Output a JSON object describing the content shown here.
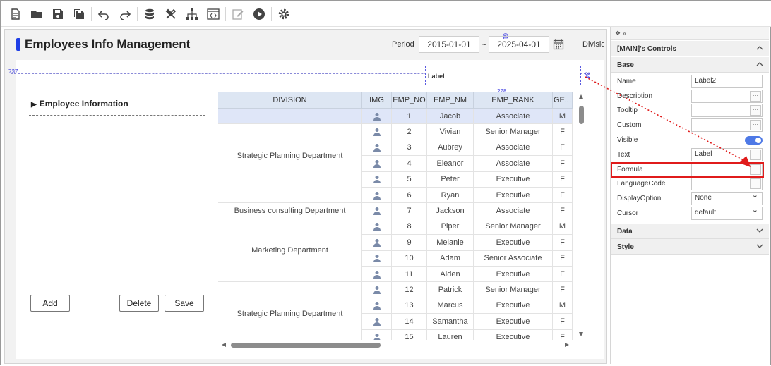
{
  "toolbar": {
    "icons": [
      "new-document-icon",
      "open-folder-icon",
      "save-icon",
      "save-all-icon",
      "undo-icon",
      "redo-icon",
      "database-icon",
      "tools-icon",
      "hierarchy-icon",
      "code-view-icon",
      "edit-icon",
      "run-icon",
      "settings-icon"
    ]
  },
  "header": {
    "title": "Employees Info Management",
    "period_label": "Period",
    "date_from": "2015-01-01",
    "date_to": "2025-04-01",
    "tilde": "~",
    "division_label": "Divisio"
  },
  "guides": {
    "label_737": "737",
    "label_278": "278",
    "label_34": "34",
    "label_61": "61"
  },
  "selected_control": {
    "text": "Label"
  },
  "left_panel": {
    "title": "Employee Information",
    "add_label": "Add",
    "delete_label": "Delete",
    "save_label": "Save"
  },
  "grid": {
    "columns": [
      "DIVISION",
      "IMG",
      "EMP_NO",
      "EMP_NM",
      "EMP_RANK",
      "GE..."
    ],
    "divisions": [
      {
        "name": "Strategic Planning Department",
        "rows": 6
      },
      {
        "name": "Business consulting Department",
        "rows": 1
      },
      {
        "name": "Marketing Department",
        "rows": 4
      },
      {
        "name": "Strategic Planning Department",
        "rows": 4
      }
    ],
    "rows": [
      {
        "no": "1",
        "name": "Jacob",
        "rank": "Associate",
        "gender": "M"
      },
      {
        "no": "2",
        "name": "Vivian",
        "rank": "Senior Manager",
        "gender": "F"
      },
      {
        "no": "3",
        "name": "Aubrey",
        "rank": "Associate",
        "gender": "F"
      },
      {
        "no": "4",
        "name": "Eleanor",
        "rank": "Associate",
        "gender": "F"
      },
      {
        "no": "5",
        "name": "Peter",
        "rank": "Executive",
        "gender": "F"
      },
      {
        "no": "6",
        "name": "Ryan",
        "rank": "Executive",
        "gender": "F"
      },
      {
        "no": "7",
        "name": "Jackson",
        "rank": "Associate",
        "gender": "F"
      },
      {
        "no": "8",
        "name": "Piper",
        "rank": "Senior Manager",
        "gender": "M"
      },
      {
        "no": "9",
        "name": "Melanie",
        "rank": "Executive",
        "gender": "F"
      },
      {
        "no": "10",
        "name": "Adam",
        "rank": "Senior Associate",
        "gender": "F"
      },
      {
        "no": "11",
        "name": "Aiden",
        "rank": "Executive",
        "gender": "F"
      },
      {
        "no": "12",
        "name": "Patrick",
        "rank": "Senior Manager",
        "gender": "F"
      },
      {
        "no": "13",
        "name": "Marcus",
        "rank": "Executive",
        "gender": "M"
      },
      {
        "no": "14",
        "name": "Samantha",
        "rank": "Executive",
        "gender": "F"
      },
      {
        "no": "15",
        "name": "Lauren",
        "rank": "Executive",
        "gender": "F"
      }
    ]
  },
  "props": {
    "top_bar": "❖ »",
    "header": "[MAIN]'s Controls",
    "base_section": "Base",
    "data_section": "Data",
    "style_section": "Style",
    "name_label": "Name",
    "name_value": "Label2",
    "description_label": "Description",
    "tooltip_label": "Tooltip",
    "custom_label": "Custom",
    "visible_label": "Visible",
    "text_label": "Text",
    "text_value": "Label",
    "formula_label": "Formula",
    "languagecode_label": "LanguageCode",
    "displayoption_label": "DisplayOption",
    "displayoption_value": "None",
    "cursor_label": "Cursor",
    "cursor_value": "default",
    "dots": "···"
  },
  "colors": {
    "accent": "#1f3fe6",
    "highlight": "#e01b1b",
    "grid_header": "#dde6f3",
    "toggle": "#4e79e6"
  }
}
